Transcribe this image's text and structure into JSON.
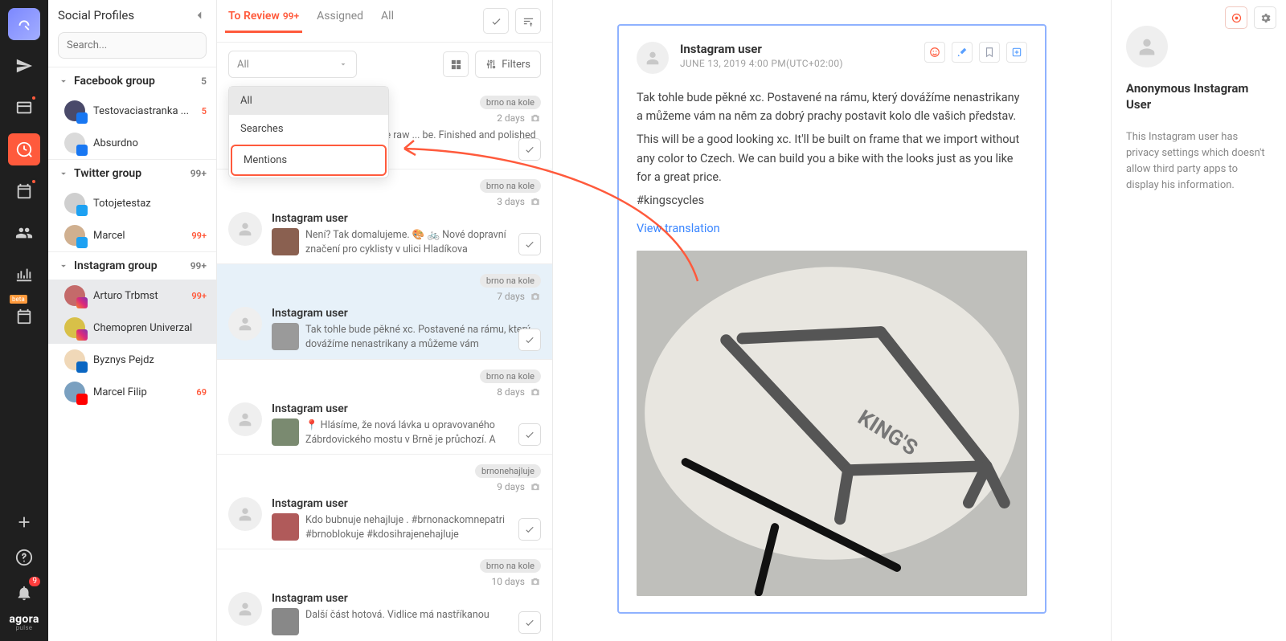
{
  "sidebar_title": "Social Profiles",
  "search_placeholder": "Search...",
  "groups": [
    {
      "name": "Facebook group",
      "count": "5",
      "orange": false,
      "items": [
        {
          "name": "Testovaciastranka ...",
          "count": "5",
          "net": "fb",
          "sel": false,
          "avatar": "#4a4a6a"
        },
        {
          "name": "Absurdno",
          "count": "",
          "net": "fb",
          "sel": false,
          "avatar": "#dadada"
        }
      ]
    },
    {
      "name": "Twitter group",
      "count": "99+",
      "orange": false,
      "items": [
        {
          "name": "Totojetestaz",
          "count": "",
          "net": "tw",
          "sel": false,
          "avatar": "#cfcfcf"
        },
        {
          "name": "Marcel",
          "count": "99+",
          "net": "tw",
          "sel": false,
          "avatar": "#d0b090"
        }
      ]
    },
    {
      "name": "Instagram group",
      "count": "99+",
      "orange": false,
      "items": [
        {
          "name": "Arturo Trbmst",
          "count": "99+",
          "net": "ig",
          "sel": true,
          "avatar": "#c46a6a"
        },
        {
          "name": "Chemopren Univerzal",
          "count": "",
          "net": "ig",
          "sel": true,
          "avatar": "#d8c048"
        },
        {
          "name": "Byznys Pejdz",
          "count": "",
          "net": "li",
          "sel": false,
          "avatar": "#f0d8b8"
        },
        {
          "name": "Marcel Filip",
          "count": "69",
          "net": "yt",
          "sel": false,
          "avatar": "#7aa0c0"
        }
      ]
    }
  ],
  "tabs": {
    "review": "To Review",
    "review_count": "99+",
    "assigned": "Assigned",
    "all": "All"
  },
  "dropdown": {
    "label": "All",
    "options": [
      "All",
      "Searches",
      "Mentions"
    ]
  },
  "filters_label": "Filters",
  "items": [
    {
      "tag": "brno na kole",
      "age": "2 days",
      "name": "",
      "snippet": "... rého rámu. Tohle raw ... be. Finished and polished",
      "thumb": "#a8b0b8",
      "sel": false
    },
    {
      "tag": "brno na kole",
      "age": "3 days",
      "name": "Instagram user",
      "snippet": "Není? Tak domalujeme. 🎨 🚲  Nové dopravní značení pro cyklisty v ulici Hladíkova",
      "thumb": "#8a6050",
      "sel": false
    },
    {
      "tag": "brno na kole",
      "age": "7 days",
      "name": "Instagram user",
      "snippet": "Tak tohle bude pěkné xc. Postavené na rámu, který dovážíme nenastrikany a můžeme vám",
      "thumb": "#9a9a9a",
      "sel": true
    },
    {
      "tag": "brno na kole",
      "age": "8 days",
      "name": "Instagram user",
      "snippet": "📍 Hlásíme, že nová lávka u opravovaného Zábrdovického mostu v Brně je průchozí. A",
      "thumb": "#7a8a70",
      "sel": false
    },
    {
      "tag": "brnonehajluje",
      "age": "9 days",
      "name": "Instagram user",
      "snippet": "Kdo bubnuje nehajluje . #brnonackomnepatri #brnoblokuje #kdosihrajenehajluje",
      "thumb": "#b05a5a",
      "sel": false
    },
    {
      "tag": "brno na kole",
      "age": "10 days",
      "name": "Instagram user",
      "snippet": "Další část hotová. Vidlice má nastříkanou",
      "thumb": "#888",
      "sel": false
    }
  ],
  "detail": {
    "name": "Instagram user",
    "timestamp": "JUNE 13, 2019 4:00 PM(UTC+02:00)",
    "paragraphs": [
      "Tak tohle bude pěkné xc. Postavené na rámu, který dovážíme nenastrikany a můžeme vám na něm za dobrý prachy postavit kolo dle vašich představ.",
      "This will be a good looking xc. It'll be built on frame that we import without any color to Czech. We can build you a bike with the looks just as you like for a great price."
    ],
    "hashtag": "#kingscycles",
    "translate": "View translation"
  },
  "user_panel": {
    "name": "Anonymous Instagram User",
    "note": "This Instagram user has privacy settings which doesn't allow third party apps to display his information."
  },
  "brand": "agora",
  "brand_sub": "pulse"
}
